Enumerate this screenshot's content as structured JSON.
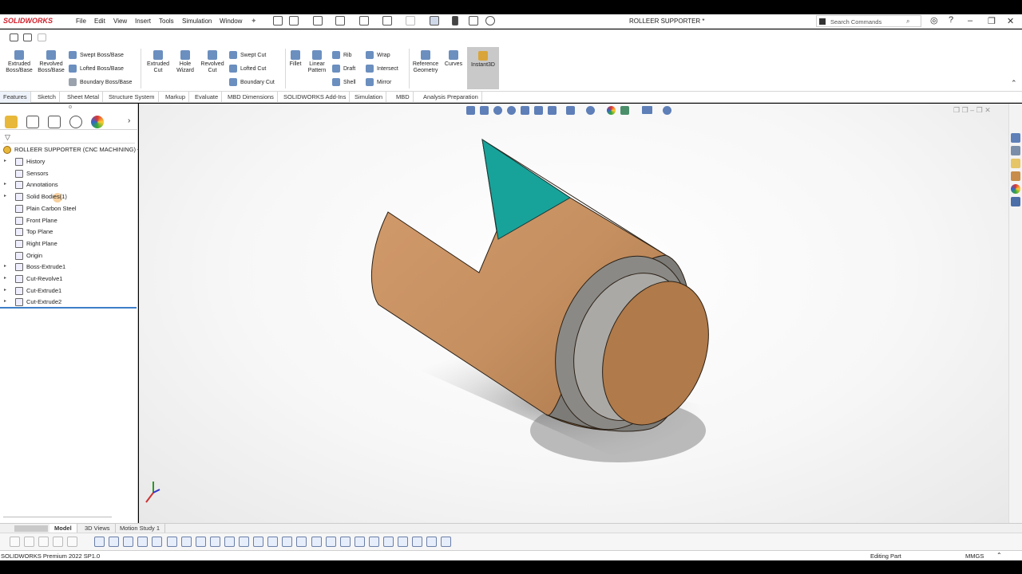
{
  "app": {
    "brand": "SOLIDWORKS",
    "document_title": "ROLLEER SUPPORTER *",
    "menus": [
      "File",
      "Edit",
      "View",
      "Insert",
      "Tools",
      "Simulation",
      "Window"
    ]
  },
  "search": {
    "placeholder": "Search Commands"
  },
  "command_manager": {
    "extruded_boss": "Extruded Boss/Base",
    "revolved_boss": "Revolved Boss/Base",
    "swept_boss": "Swept Boss/Base",
    "lofted_boss": "Lofted Boss/Base",
    "boundary_boss": "Boundary Boss/Base",
    "extruded_cut": "Extruded Cut",
    "hole_wizard": "Hole Wizard",
    "revolved_cut": "Revolved Cut",
    "swept_cut": "Swept Cut",
    "lofted_cut": "Lofted Cut",
    "boundary_cut": "Boundary Cut",
    "fillet": "Fillet",
    "linear_pattern": "Linear Pattern",
    "rib": "Rib",
    "draft": "Draft",
    "shell": "Shell",
    "wrap": "Wrap",
    "intersect": "Intersect",
    "mirror": "Mirror",
    "reference_geometry": "Reference Geometry",
    "curves": "Curves",
    "instant3d": "Instant3D"
  },
  "tabs": [
    "Features",
    "Sketch",
    "Sheet Metal",
    "Structure System",
    "Markup",
    "Evaluate",
    "MBD Dimensions",
    "SOLIDWORKS Add-Ins",
    "Simulation",
    "MBD",
    "Analysis Preparation"
  ],
  "tree": {
    "root": "ROLLEER SUPPORTER (CNC MACHINING) <",
    "items": [
      {
        "label": "History",
        "arrow": true
      },
      {
        "label": "Sensors",
        "arrow": false
      },
      {
        "label": "Annotations",
        "arrow": true
      },
      {
        "label": "Solid Bodies(1)",
        "arrow": true
      },
      {
        "label": "Plain Carbon Steel",
        "arrow": false
      },
      {
        "label": "Front Plane",
        "arrow": false
      },
      {
        "label": "Top Plane",
        "arrow": false
      },
      {
        "label": "Right Plane",
        "arrow": false
      },
      {
        "label": "Origin",
        "arrow": false
      },
      {
        "label": "Boss-Extrude1",
        "arrow": true
      },
      {
        "label": "Cut-Revolve1",
        "arrow": true
      },
      {
        "label": "Cut-Extrude1",
        "arrow": true
      },
      {
        "label": "Cut-Extrude2",
        "arrow": true
      }
    ]
  },
  "bottom_tabs": [
    "Model",
    "3D Views",
    "Motion Study 1"
  ],
  "status": {
    "version": "SOLIDWORKS Premium 2022 SP1.0",
    "mode": "Editing Part",
    "units": "MMGS"
  },
  "colors": {
    "body": "#c58f60",
    "body_dark": "#8a6440",
    "bore": "#9a9a98",
    "teal_face": "#18a39a",
    "brand": "#d0202c",
    "instant3d_bg": "#c9c9c9"
  }
}
